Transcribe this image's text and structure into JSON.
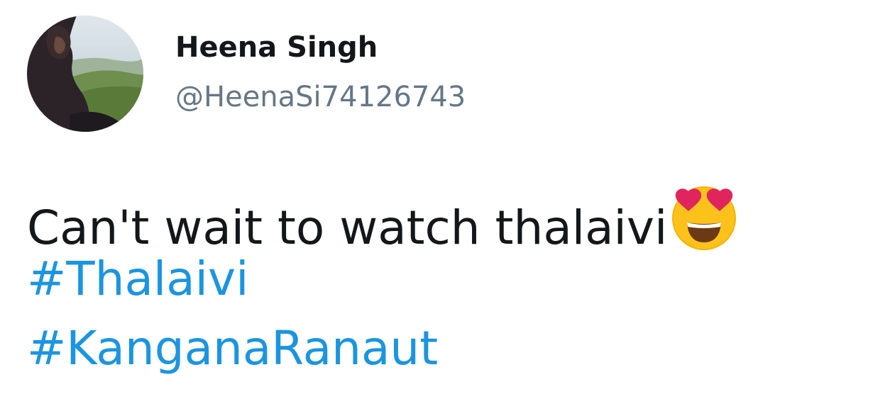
{
  "user": {
    "display_name": "Heena Singh",
    "handle": "@HeenaSi74126743"
  },
  "tweet": {
    "text": "Can't wait to watch thalaivi",
    "emoji": "smiling-face-with-heart-eyes",
    "hashtags": [
      "#Thalaivi",
      "#KanganaRanaut"
    ]
  },
  "colors": {
    "text": "#14171a",
    "handle": "#657786",
    "hashtag": "#1b95e0"
  }
}
